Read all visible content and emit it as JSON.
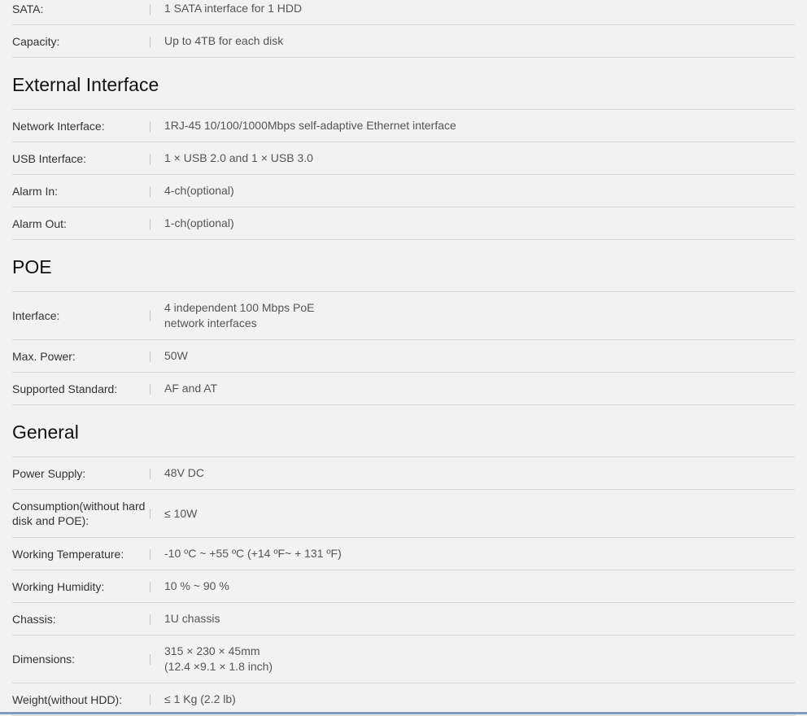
{
  "storage_rows": [
    {
      "label": "SATA:",
      "value": [
        "1 SATA interface for 1 HDD"
      ]
    },
    {
      "label": "Capacity:",
      "value": [
        "Up to 4TB for each disk"
      ]
    }
  ],
  "sections": [
    {
      "title": "External Interface",
      "rows": [
        {
          "label": "Network Interface:",
          "value": [
            "1RJ-45 10/100/1000Mbps self-adaptive Ethernet interface"
          ]
        },
        {
          "label": "USB Interface:",
          "value": [
            "1 × USB 2.0 and 1 × USB 3.0"
          ]
        },
        {
          "label": "Alarm In:",
          "value": [
            "4-ch(optional)"
          ]
        },
        {
          "label": "Alarm Out:",
          "value": [
            "1-ch(optional)"
          ]
        }
      ]
    },
    {
      "title": "POE",
      "rows": [
        {
          "label": "Interface:",
          "value": [
            "4 independent 100 Mbps PoE",
            "network interfaces"
          ]
        },
        {
          "label": "Max. Power:",
          "value": [
            "50W"
          ]
        },
        {
          "label": "Supported Standard:",
          "value": [
            "AF and AT"
          ]
        }
      ]
    },
    {
      "title": "General",
      "rows": [
        {
          "label": "Power Supply:",
          "value": [
            "48V DC"
          ]
        },
        {
          "label": "Consumption(without hard disk and POE):",
          "value": [
            "≤ 10W"
          ]
        },
        {
          "label": "Working Temperature:",
          "value": [
            "-10 ºC ~ +55 ºC (+14 ºF~ + 131 ºF)"
          ]
        },
        {
          "label": "Working Humidity:",
          "value": [
            "10 % ~ 90 %"
          ]
        },
        {
          "label": "Chassis:",
          "value": [
            "1U chassis"
          ]
        },
        {
          "label": "Dimensions:",
          "value": [
            "315 × 230 × 45mm",
            "(12.4 ×9.1 × 1.8 inch)"
          ]
        },
        {
          "label": "Weight(without HDD):",
          "value": [
            "≤ 1 Kg (2.2 lb)"
          ]
        }
      ]
    }
  ],
  "colors": {
    "background": "#f2f2f2",
    "divider": "#d6d6d6",
    "bottom_bar": "#7d9bc2"
  }
}
